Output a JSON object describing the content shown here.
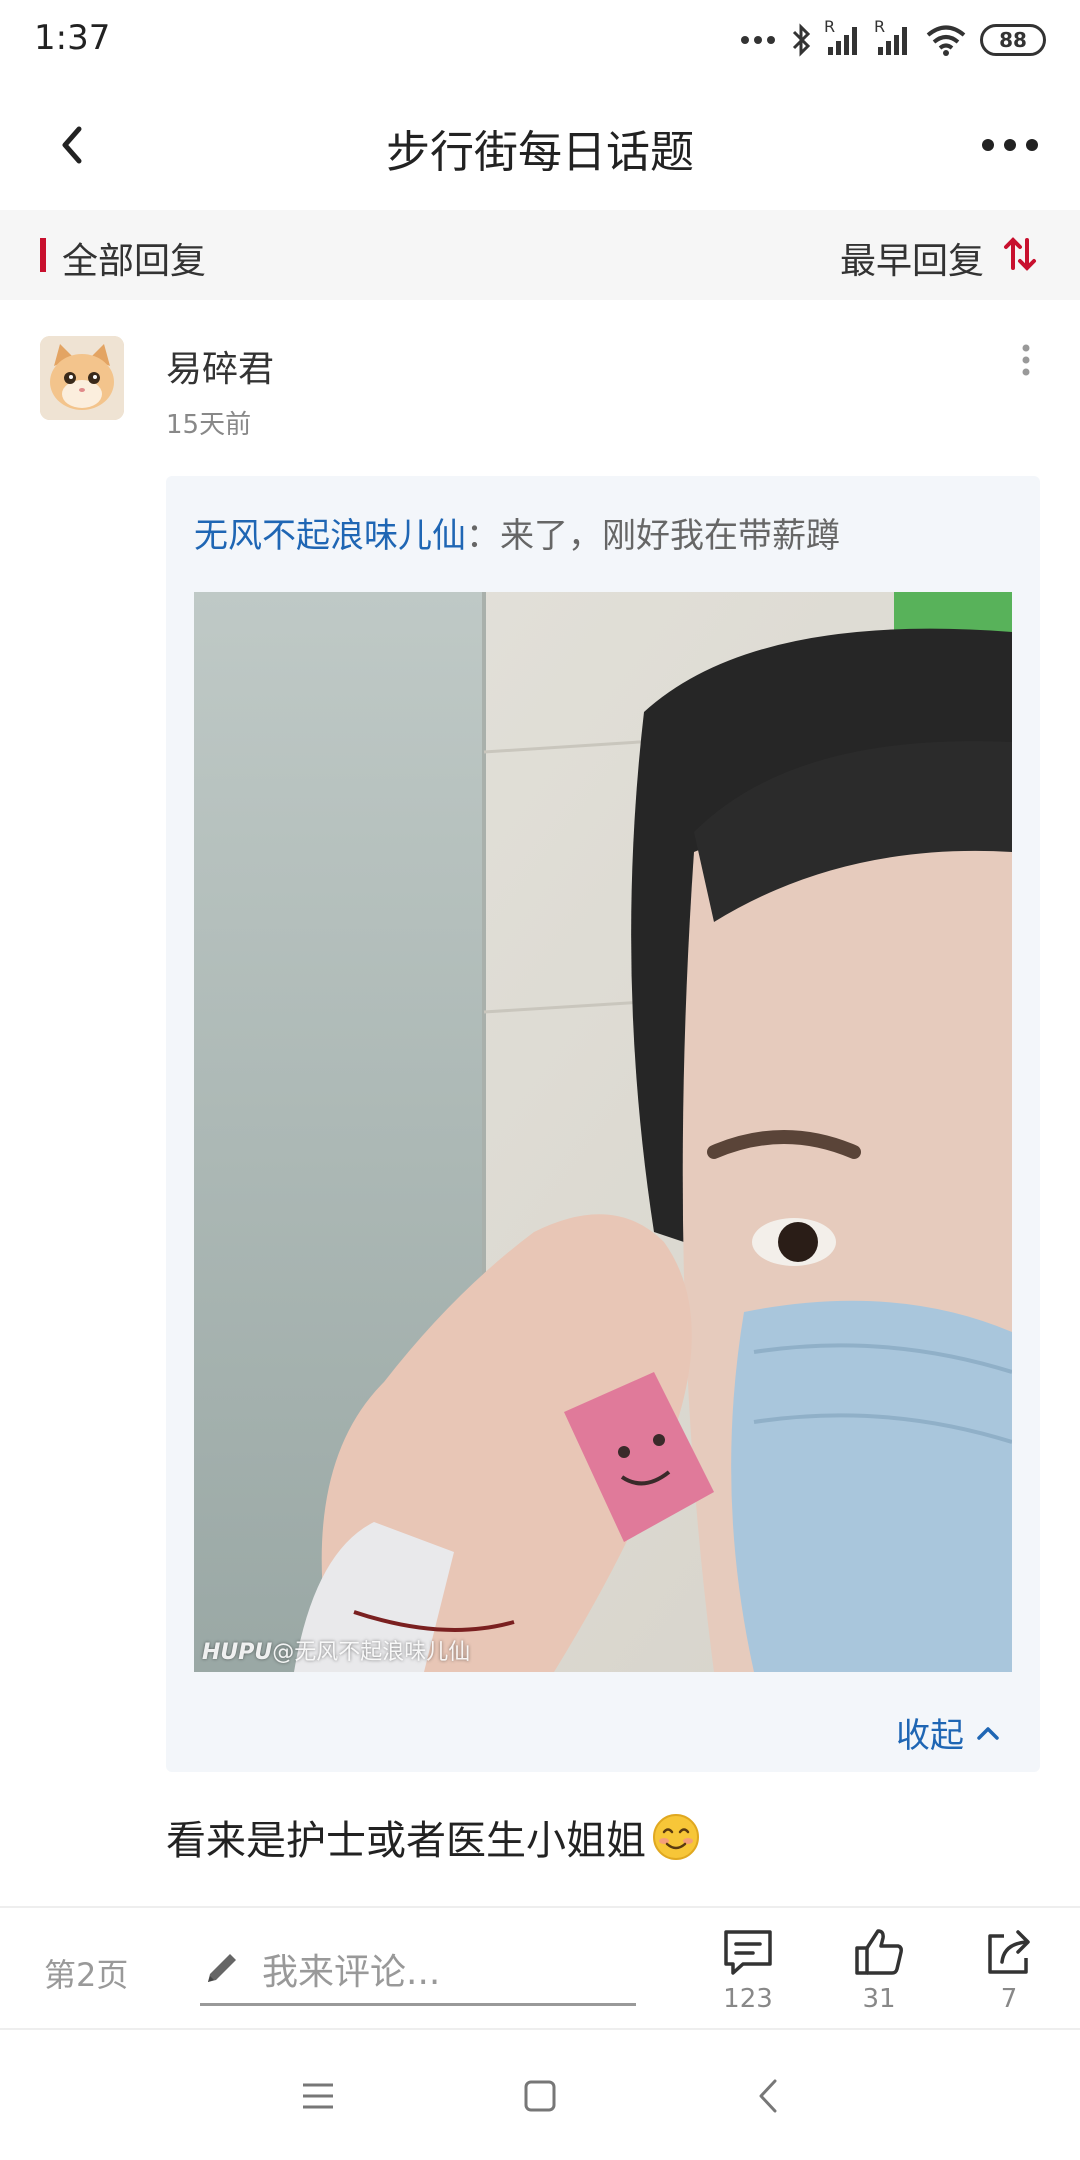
{
  "status_bar": {
    "time": "1:37",
    "battery": "88",
    "signal_label_1": "R",
    "signal_label_2": "R"
  },
  "header": {
    "title": "步行街每日话题",
    "back_icon": "chevron-left-icon",
    "more_icon": "more-horizontal-icon"
  },
  "filter_bar": {
    "all_replies": "全部回复",
    "sort_label": "最早回复",
    "sort_icon": "sort-arrows-icon",
    "accent_color": "#c8102e"
  },
  "comment": {
    "username": "易碎君",
    "time": "15天前",
    "quote": {
      "author": "无风不起浪味儿仙",
      "separator": "：",
      "text": "来了，刚好我在带薪蹲",
      "watermark_brand": "HUPU",
      "watermark_user": "@无风不起浪味儿仙",
      "collapse_label": "收起"
    },
    "text": "看来是护士或者医生小姐姐",
    "emoji": "😊"
  },
  "action_bar": {
    "page": "第2页",
    "input_placeholder": "我来评论...",
    "comments_count": "123",
    "likes_count": "31",
    "shares_count": "7"
  },
  "colors": {
    "link_blue": "#1f66b4",
    "accent_red": "#c8102e"
  }
}
